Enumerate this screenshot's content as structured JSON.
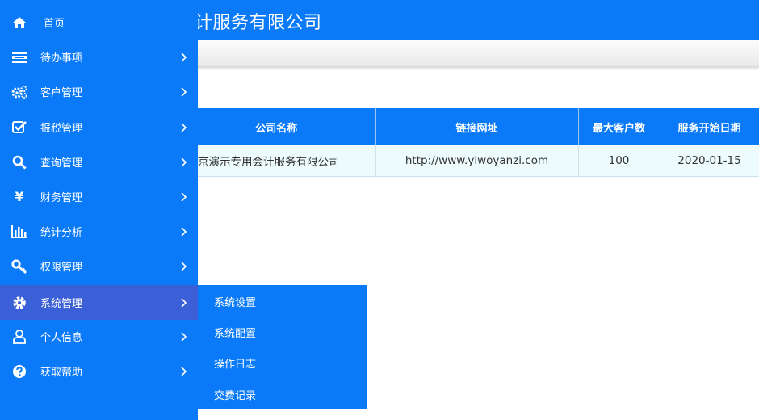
{
  "header": {
    "title": "计服务有限公司"
  },
  "colors": {
    "primary": "#0a7af9",
    "active_item": "#3b5fd6",
    "row_bg": "#eefbfc"
  },
  "sidebar": {
    "items": [
      {
        "label": "首页",
        "icon": "home-icon"
      },
      {
        "label": "待办事项",
        "icon": "list-icon"
      },
      {
        "label": "客户管理",
        "icon": "cogs-icon"
      },
      {
        "label": "报税管理",
        "icon": "check-square-icon"
      },
      {
        "label": "查询管理",
        "icon": "search-icon"
      },
      {
        "label": "财务管理",
        "icon": "yen-icon"
      },
      {
        "label": "统计分析",
        "icon": "bar-chart-icon"
      },
      {
        "label": "权限管理",
        "icon": "key-icon"
      },
      {
        "label": "系统管理",
        "icon": "gear-icon"
      },
      {
        "label": "个人信息",
        "icon": "user-icon"
      },
      {
        "label": "获取帮助",
        "icon": "help-icon"
      }
    ],
    "active": "系统管理"
  },
  "submenu": {
    "items": [
      "系统设置",
      "系统配置",
      "操作日志",
      "交费记录"
    ]
  },
  "table": {
    "headers": [
      "公司名称",
      "链接网址",
      "最大客户数",
      "服务开始日期"
    ],
    "rows": [
      [
        "北京演示专用会计服务有限公司",
        "http://www.yiwoyanzi.com",
        "100",
        "2020-01-15"
      ]
    ]
  }
}
